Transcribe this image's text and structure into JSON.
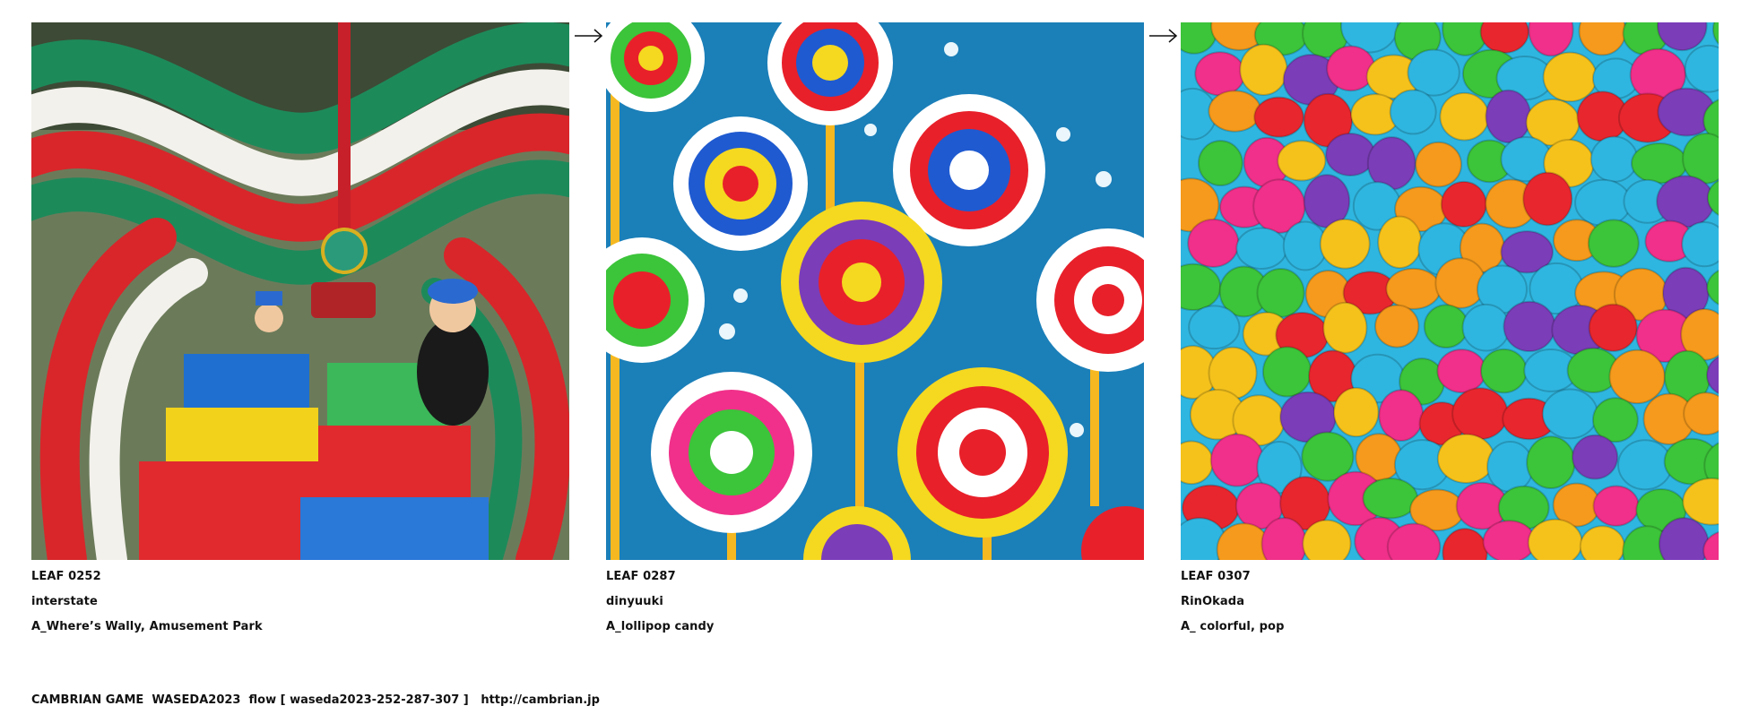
{
  "panels": [
    {
      "leaf": "LEAF 0252",
      "author": "interstate",
      "prompt": "A_Where’s   Wally, Amusement Park",
      "image_subject": "colorful inflatable amusement park slides with costumed figures"
    },
    {
      "leaf": "LEAF 0287",
      "author": "dinyuuki",
      "prompt": "A_lollipop candy",
      "image_subject": "swirled lollipops on blue background"
    },
    {
      "leaf": "LEAF 0307",
      "author": "RinOkada",
      "prompt": "A_ colorful, pop",
      "image_subject": "pile of brightly colored candy pieces"
    }
  ],
  "footer": "CAMBRIAN GAME  WASEDA2023  flow [ waseda2023-252-287-307 ]   http://cambrian.jp",
  "icons": {
    "arrow": "right-arrow-icon"
  },
  "colors": {
    "park_red": "#d8262a",
    "park_green": "#1d8a5a",
    "park_white": "#f3f1ec",
    "lolly_bg": "#1b7fb8",
    "candy_blue": "#2fb6e0",
    "candy_pink": "#f0308a",
    "candy_orange": "#f59a1c",
    "candy_green": "#3cc43a",
    "candy_purple": "#7b3db8"
  }
}
